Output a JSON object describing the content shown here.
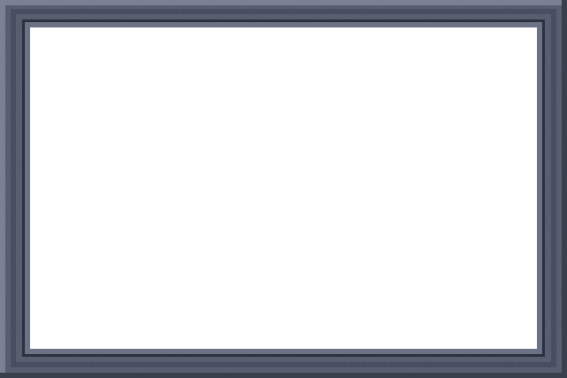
{
  "picture_frame": {
    "colors": {
      "outer_molding": "#5a6072",
      "outer_highlight": "#7b8194",
      "outer_shadow": "#3a3f4e",
      "mid_groove": "#4a5062",
      "inner_lip": "#2c3140",
      "inner_lip_highlight": "#6c7285",
      "opening": "#ffffff"
    }
  }
}
